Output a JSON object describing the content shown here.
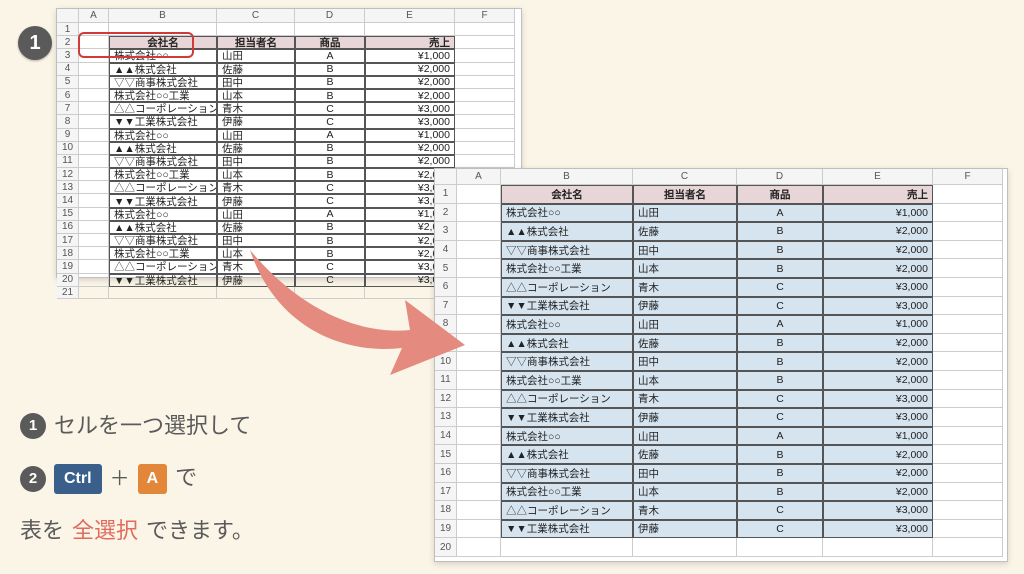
{
  "columns": [
    "A",
    "B",
    "C",
    "D",
    "E",
    "F"
  ],
  "headers": {
    "company": "会社名",
    "person": "担当者名",
    "product": "商品",
    "sales": "売上"
  },
  "rows": [
    {
      "company": "株式会社○○",
      "person": "山田",
      "product": "A",
      "sales": "¥1,000"
    },
    {
      "company": "▲▲株式会社",
      "person": "佐藤",
      "product": "B",
      "sales": "¥2,000"
    },
    {
      "company": "▽▽商事株式会社",
      "person": "田中",
      "product": "B",
      "sales": "¥2,000"
    },
    {
      "company": "株式会社○○工業",
      "person": "山本",
      "product": "B",
      "sales": "¥2,000"
    },
    {
      "company": "△△コーポレーション",
      "person": "青木",
      "product": "C",
      "sales": "¥3,000"
    },
    {
      "company": "▼▼工業株式会社",
      "person": "伊藤",
      "product": "C",
      "sales": "¥3,000"
    },
    {
      "company": "株式会社○○",
      "person": "山田",
      "product": "A",
      "sales": "¥1,000"
    },
    {
      "company": "▲▲株式会社",
      "person": "佐藤",
      "product": "B",
      "sales": "¥2,000"
    },
    {
      "company": "▽▽商事株式会社",
      "person": "田中",
      "product": "B",
      "sales": "¥2,000"
    },
    {
      "company": "株式会社○○工業",
      "person": "山本",
      "product": "B",
      "sales": "¥2,000"
    },
    {
      "company": "△△コーポレーション",
      "person": "青木",
      "product": "C",
      "sales": "¥3,000"
    },
    {
      "company": "▼▼工業株式会社",
      "person": "伊藤",
      "product": "C",
      "sales": "¥3,000"
    },
    {
      "company": "株式会社○○",
      "person": "山田",
      "product": "A",
      "sales": "¥1,000"
    },
    {
      "company": "▲▲株式会社",
      "person": "佐藤",
      "product": "B",
      "sales": "¥2,000"
    },
    {
      "company": "▽▽商事株式会社",
      "person": "田中",
      "product": "B",
      "sales": "¥2,000"
    },
    {
      "company": "株式会社○○工業",
      "person": "山本",
      "product": "B",
      "sales": "¥2,000"
    },
    {
      "company": "△△コーポレーション",
      "person": "青木",
      "product": "C",
      "sales": "¥3,000"
    },
    {
      "company": "▼▼工業株式会社",
      "person": "伊藤",
      "product": "C",
      "sales": "¥3,000"
    }
  ],
  "sheet1": {
    "startRow": 2,
    "rowCount": 18,
    "truncateCols": 2
  },
  "sheet2": {
    "startRow": 1,
    "rowCount": 18
  },
  "badges": {
    "step1": "1",
    "step2": "2"
  },
  "instr": {
    "line1_a": "セルを一つ選択して",
    "line2_tail": "で",
    "line3_a": "表を",
    "line3_b": "全選択",
    "line3_c": "できます。",
    "ctrl": "Ctrl",
    "a": "A",
    "plus": "＋"
  }
}
